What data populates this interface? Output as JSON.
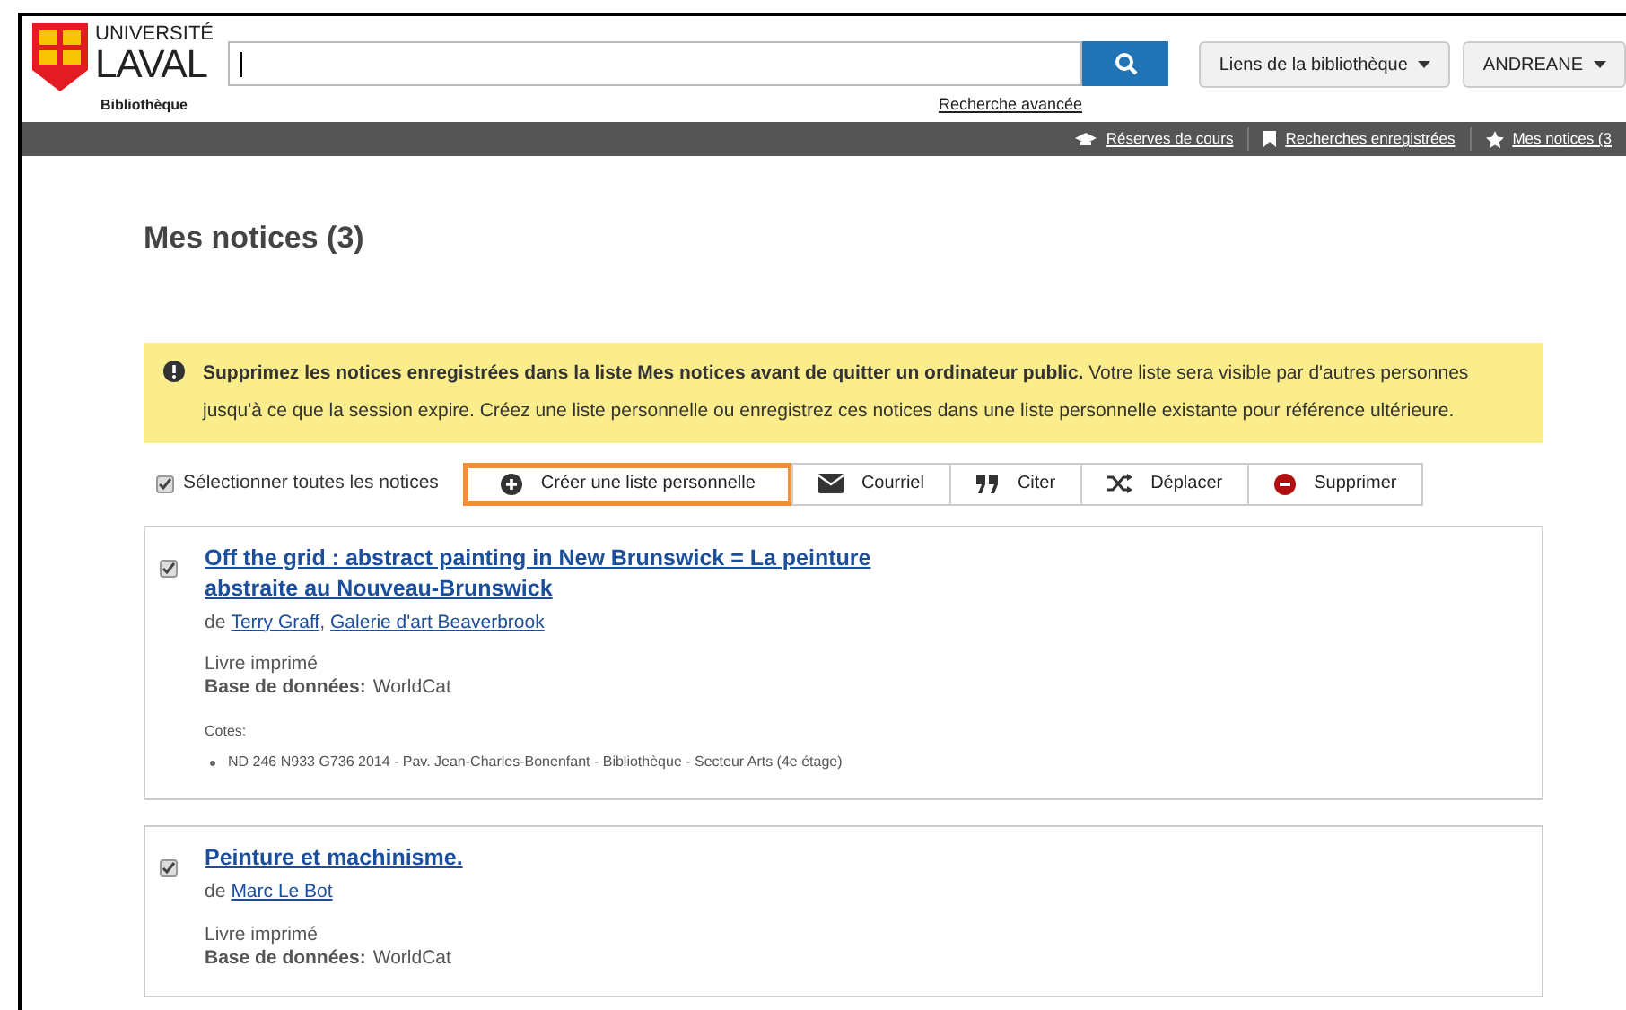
{
  "header": {
    "logo_top": "UNIVERSITÉ",
    "logo_main": "LAVAL",
    "logo_sub": "Bibliothèque",
    "advanced_search": "Recherche avancée",
    "menus": [
      {
        "label": "Liens de la bibliothèque"
      },
      {
        "label": "ANDREANE"
      }
    ]
  },
  "topbar": [
    {
      "kind": "cap",
      "label": "Réserves de cours"
    },
    {
      "kind": "bookmark",
      "label": "Recherches enregistrées"
    },
    {
      "kind": "star",
      "label": "Mes notices (3"
    }
  ],
  "title": "Mes notices (3)",
  "alert": "**Supprimez les notices enregistrées dans la liste Mes notices avant de quitter un ordinateur public.**  Votre liste sera visible par d'autres personnes jusqu'à ce que la session expire.  Créez une liste personnelle ou enregistrez ces notices dans une liste personnelle existante pour référence ultérieure.",
  "select_all": {
    "label": "Sélectionner toutes les notices",
    "checked": true
  },
  "actions": [
    {
      "kind": "plus",
      "label": "Créer une liste personnelle",
      "selected": true
    },
    {
      "kind": "mail",
      "label": "Courriel",
      "selected": false
    },
    {
      "kind": "quote",
      "label": "Citer",
      "selected": false
    },
    {
      "kind": "shuffle",
      "label": "Déplacer",
      "selected": false
    },
    {
      "kind": "minus",
      "label": "Supprimer",
      "selected": false
    }
  ],
  "records": [
    {
      "checked": true,
      "title": "Off the grid : abstract painting in New Brunswick = La peinture abstraite au Nouveau-Brunswick",
      "by": "de",
      "authors": [
        "Terry Graff",
        "Galerie d'art Beaverbrook"
      ],
      "separator": ",",
      "type": "Livre imprimé",
      "db_label": "Base de données:",
      "db": "WorldCat",
      "call_label": "Cotes:",
      "call_numbers": [
        "ND 246 N933 G736 2014 - Pav. Jean-Charles-Bonenfant - Bibliothèque - Secteur Arts (4e étage)"
      ]
    },
    {
      "checked": true,
      "title": "Peinture et machinisme.",
      "by": "de",
      "authors": [
        "Marc Le Bot"
      ],
      "type": "Livre imprimé",
      "db_label": "Base de données:",
      "db": "WorldCat"
    }
  ]
}
